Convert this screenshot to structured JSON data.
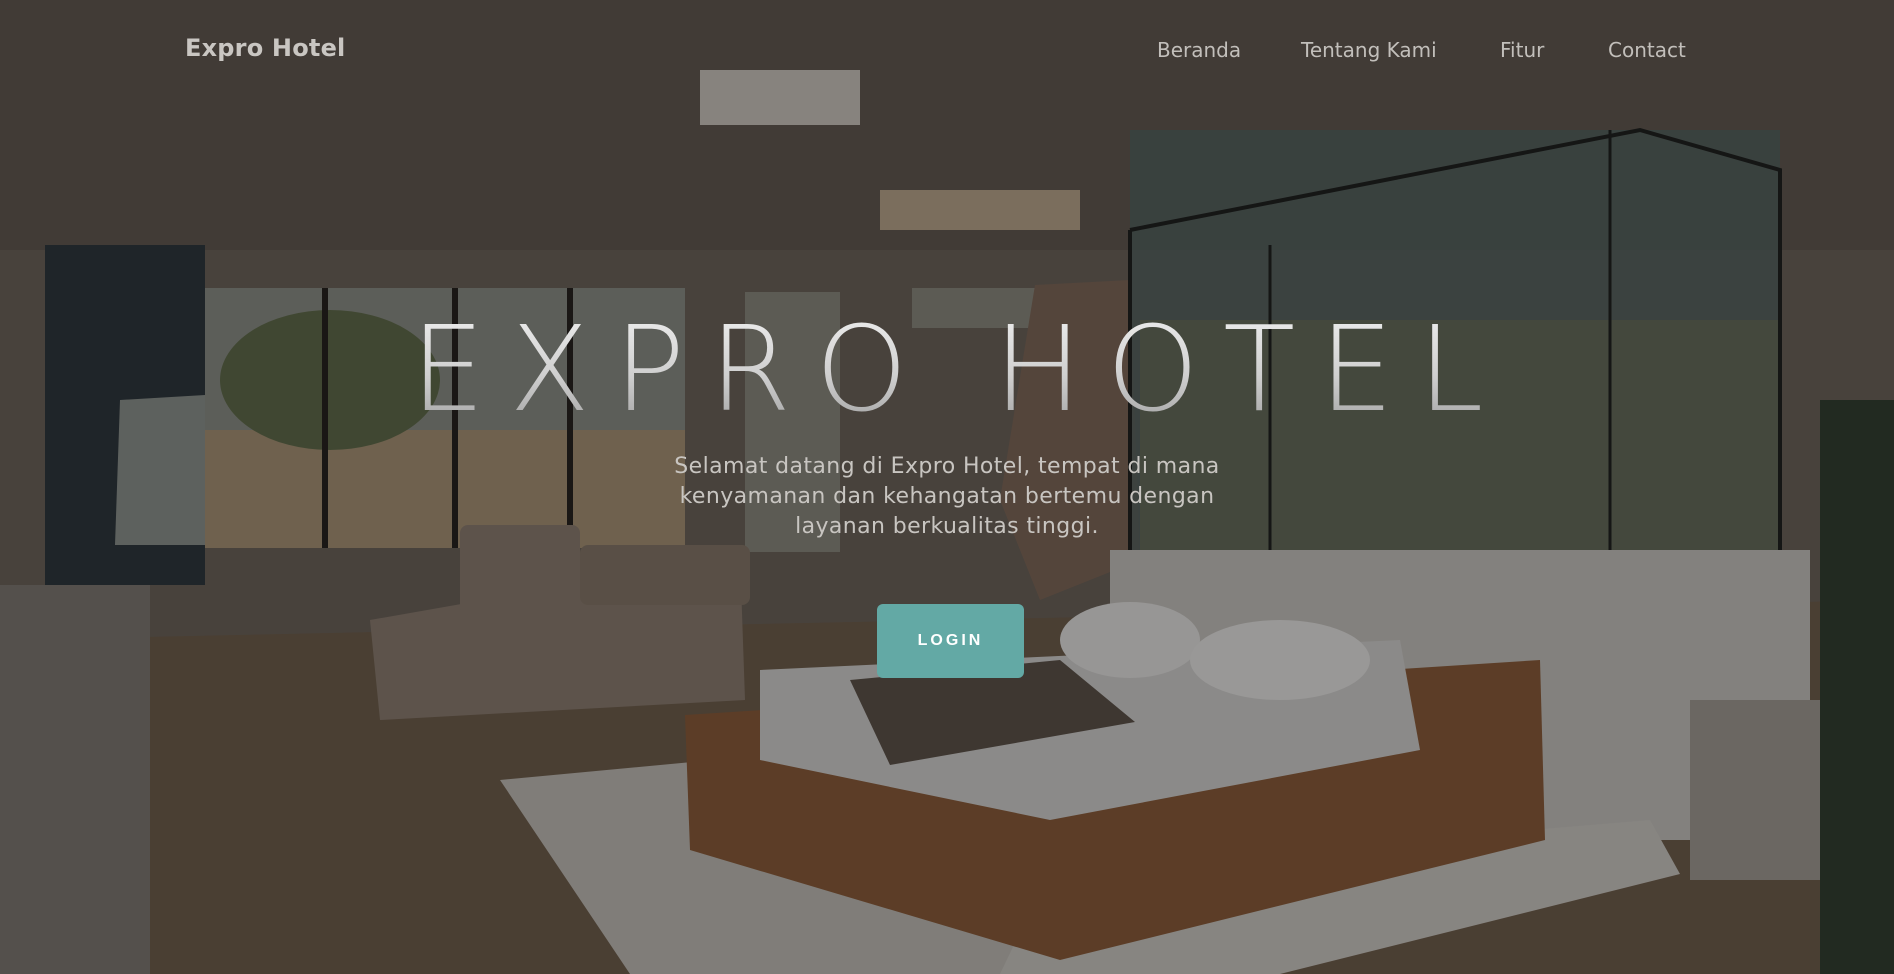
{
  "navbar": {
    "brand": "Expro Hotel",
    "links": [
      {
        "label": "Beranda"
      },
      {
        "label": "Tentang Kami"
      },
      {
        "label": "Fitur"
      },
      {
        "label": "Contact"
      }
    ]
  },
  "hero": {
    "title": "EXPRO HOTEL",
    "subtitle": "Selamat datang di Expro Hotel, tempat di mana kenyamanan dan kehangatan bertemu dengan layanan berkualitas tinggi.",
    "login_label": "LOGIN"
  },
  "colors": {
    "accent": "#63a9a5",
    "title_text": "#d9d9d9",
    "nav_text": "#c2bfbb"
  },
  "icons": {
    "background": "hotel-room-photo"
  }
}
